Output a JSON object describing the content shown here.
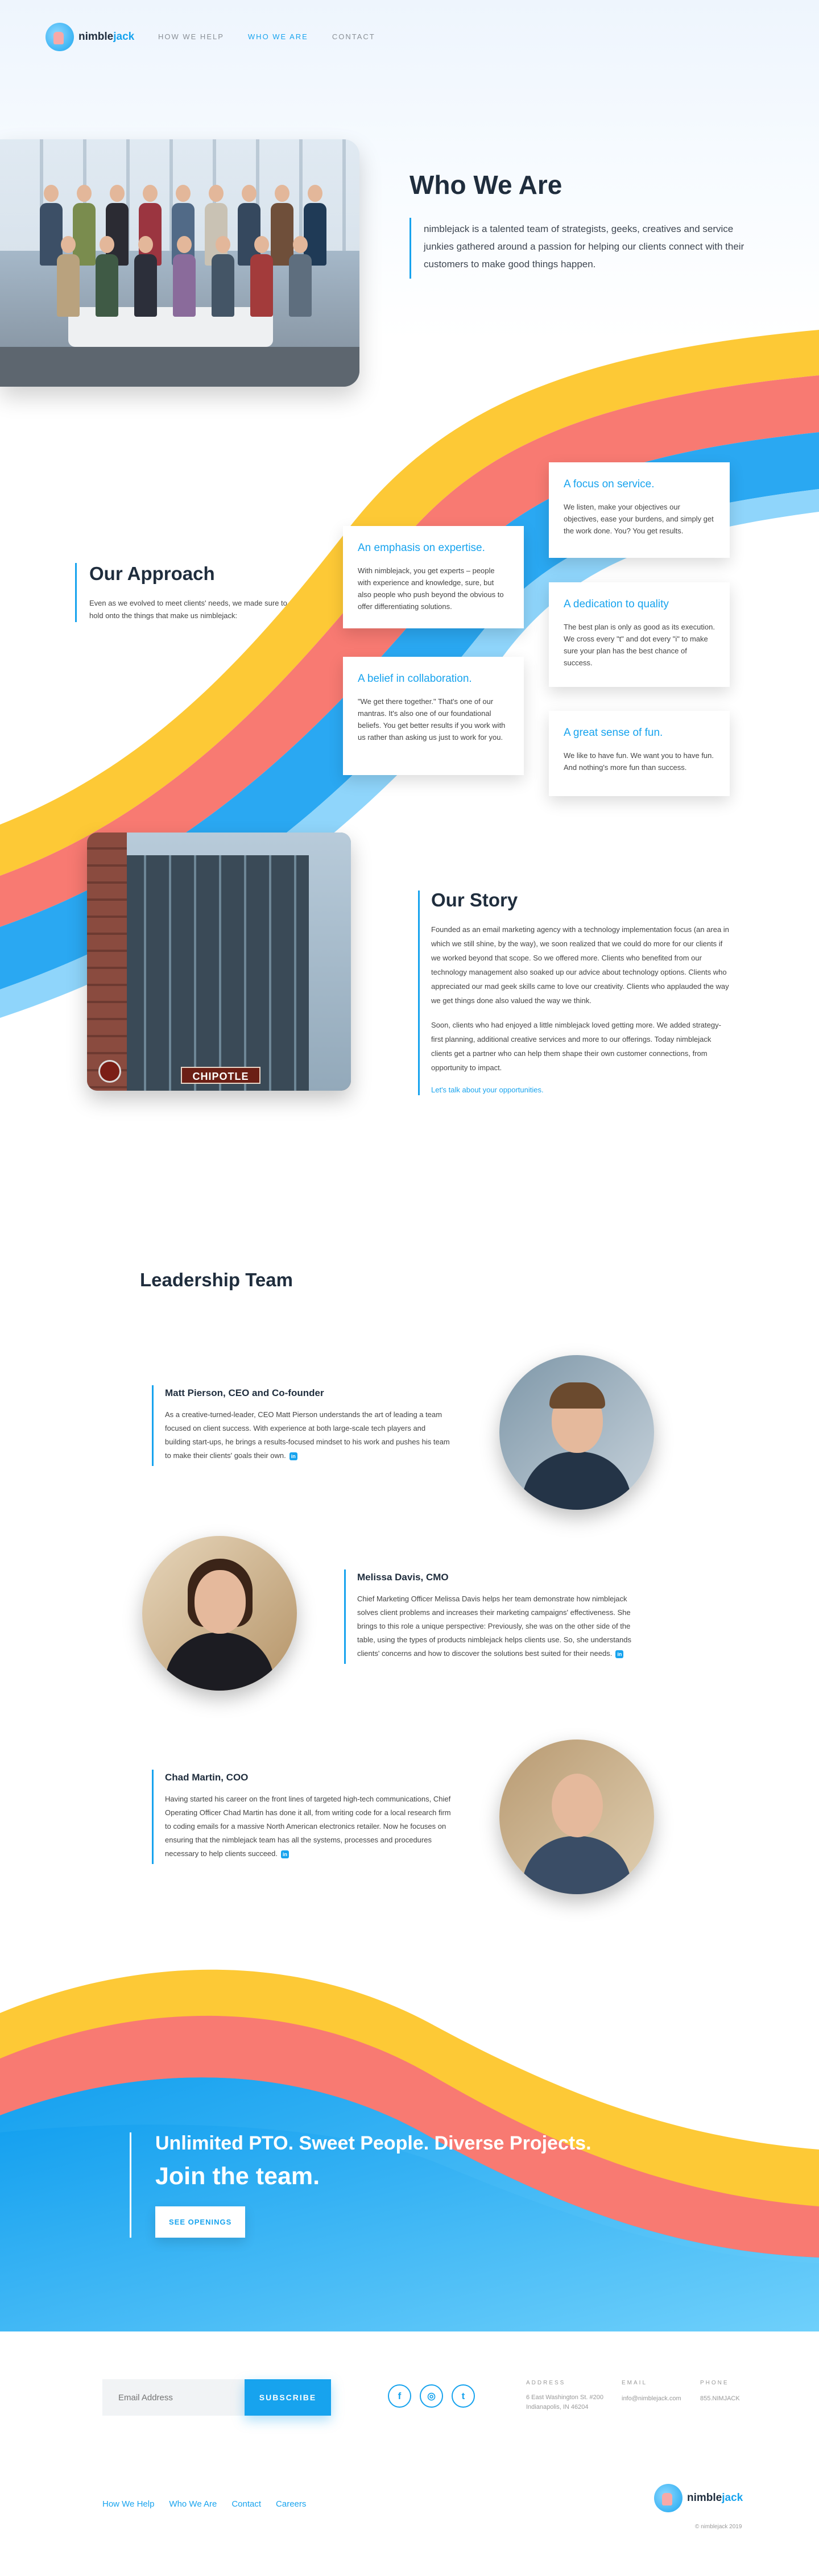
{
  "header": {
    "logo_text_a": "nimble",
    "logo_text_b": "jack",
    "nav": [
      {
        "label": "HOW WE HELP"
      },
      {
        "label": "WHO WE ARE"
      },
      {
        "label": "CONTACT"
      }
    ]
  },
  "hero": {
    "title": "Who We Are",
    "text": "nimblejack is a talented team of strategists, geeks, creatives and service junkies gathered around a passion for helping our clients connect with their customers to make good things happen."
  },
  "approach": {
    "title": "Our Approach",
    "text": "Even as we evolved to meet clients' needs, we made sure to hold onto the things that make us nimblejack:",
    "cards": [
      {
        "title": "An emphasis on expertise.",
        "text": "With nimblejack, you get experts – people with experience and knowledge, sure, but also people who push beyond the obvious to offer differentiating solutions."
      },
      {
        "title": "A belief in collaboration.",
        "text": "\"We get there together.\" That's one of our mantras. It's also one of our foundational beliefs. You get better results if you work with us rather than asking us just to work for you."
      },
      {
        "title": "A focus on service.",
        "text": "We listen, make your objectives our objectives, ease your burdens, and simply get the work done. You? You get results."
      },
      {
        "title": "A dedication to quality",
        "text": "The best plan is only as good as its execution. We cross every \"t\" and dot every \"i\" to make sure your plan has the best chance of success."
      },
      {
        "title": "A great sense of fun.",
        "text": "We like to have fun. We want you to have fun. And nothing's more fun than success."
      }
    ]
  },
  "story": {
    "title": "Our Story",
    "p1": "Founded as an email marketing agency with a technology implementation focus (an area in which we still shine, by the way), we soon realized that we could do more for our clients if we worked beyond that scope. So we offered more. Clients who benefited from our technology management also soaked up our advice about technology options. Clients who appreciated our mad geek skills came to love our creativity. Clients who applauded the way we get things done also valued the way we think.",
    "p2": "Soon, clients who had enjoyed a little nimblejack loved getting more. We added strategy-first planning, additional creative services and more to our offerings. Today nimblejack clients get a partner who can help them shape their own customer connections, from opportunity to impact.",
    "link": "Let's talk about your opportunities.",
    "sign": "CHIPOTLE"
  },
  "leadership": {
    "title": "Leadership Team",
    "members": [
      {
        "name": "Matt Pierson, CEO and Co-founder",
        "bio": "As a creative-turned-leader, CEO Matt Pierson understands the art of leading a team focused on client success. With experience at both large-scale tech players and building start-ups, he brings a results-focused mindset to his work and pushes his team to make their clients' goals their own."
      },
      {
        "name": "Melissa Davis, CMO",
        "bio": "Chief Marketing Officer Melissa Davis helps her team demonstrate how nimblejack solves client problems and increases their marketing campaigns' effectiveness. She brings to this role a unique perspective: Previously, she was on the other side of the table, using the types of products nimblejack helps clients use. So, she understands clients' concerns and how to discover the solutions best suited for their needs."
      },
      {
        "name": "Chad Martin, COO",
        "bio": "Having started his career on the front lines of targeted high-tech communications, Chief Operating Officer Chad Martin has done it all, from writing code for a local research firm to coding emails for a massive North American electronics retailer. Now he focuses on ensuring that the nimblejack team has all the systems, processes and procedures necessary to help clients succeed."
      }
    ],
    "linkedin_label": "in"
  },
  "join": {
    "line1": "Unlimited PTO.  Sweet People.  Diverse Projects.",
    "line2": "Join the team.",
    "button": "SEE OPENINGS"
  },
  "footer": {
    "email_placeholder": "Email Address",
    "subscribe": "SUBSCRIBE",
    "social": [
      {
        "icon": "facebook-icon",
        "glyph": "f"
      },
      {
        "icon": "instagram-icon",
        "glyph": "◎"
      },
      {
        "icon": "twitter-icon",
        "glyph": "t"
      }
    ],
    "address_label": "ADDRESS",
    "address_1": "6 East Washington St. #200",
    "address_2": "Indianapolis, IN 46204",
    "email_label": "EMAIL",
    "email_value": "info@nimblejack.com",
    "phone_label": "PHONE",
    "phone_value": "855.NIMJACK",
    "links": [
      "How We Help",
      "Who We Are",
      "Contact",
      "Careers"
    ],
    "copyright": "© nimblejack 2019"
  },
  "colors": {
    "accent": "#17a3ee",
    "yellow": "#fdc936",
    "coral": "#f87a72",
    "blue": "#25a7f2"
  }
}
